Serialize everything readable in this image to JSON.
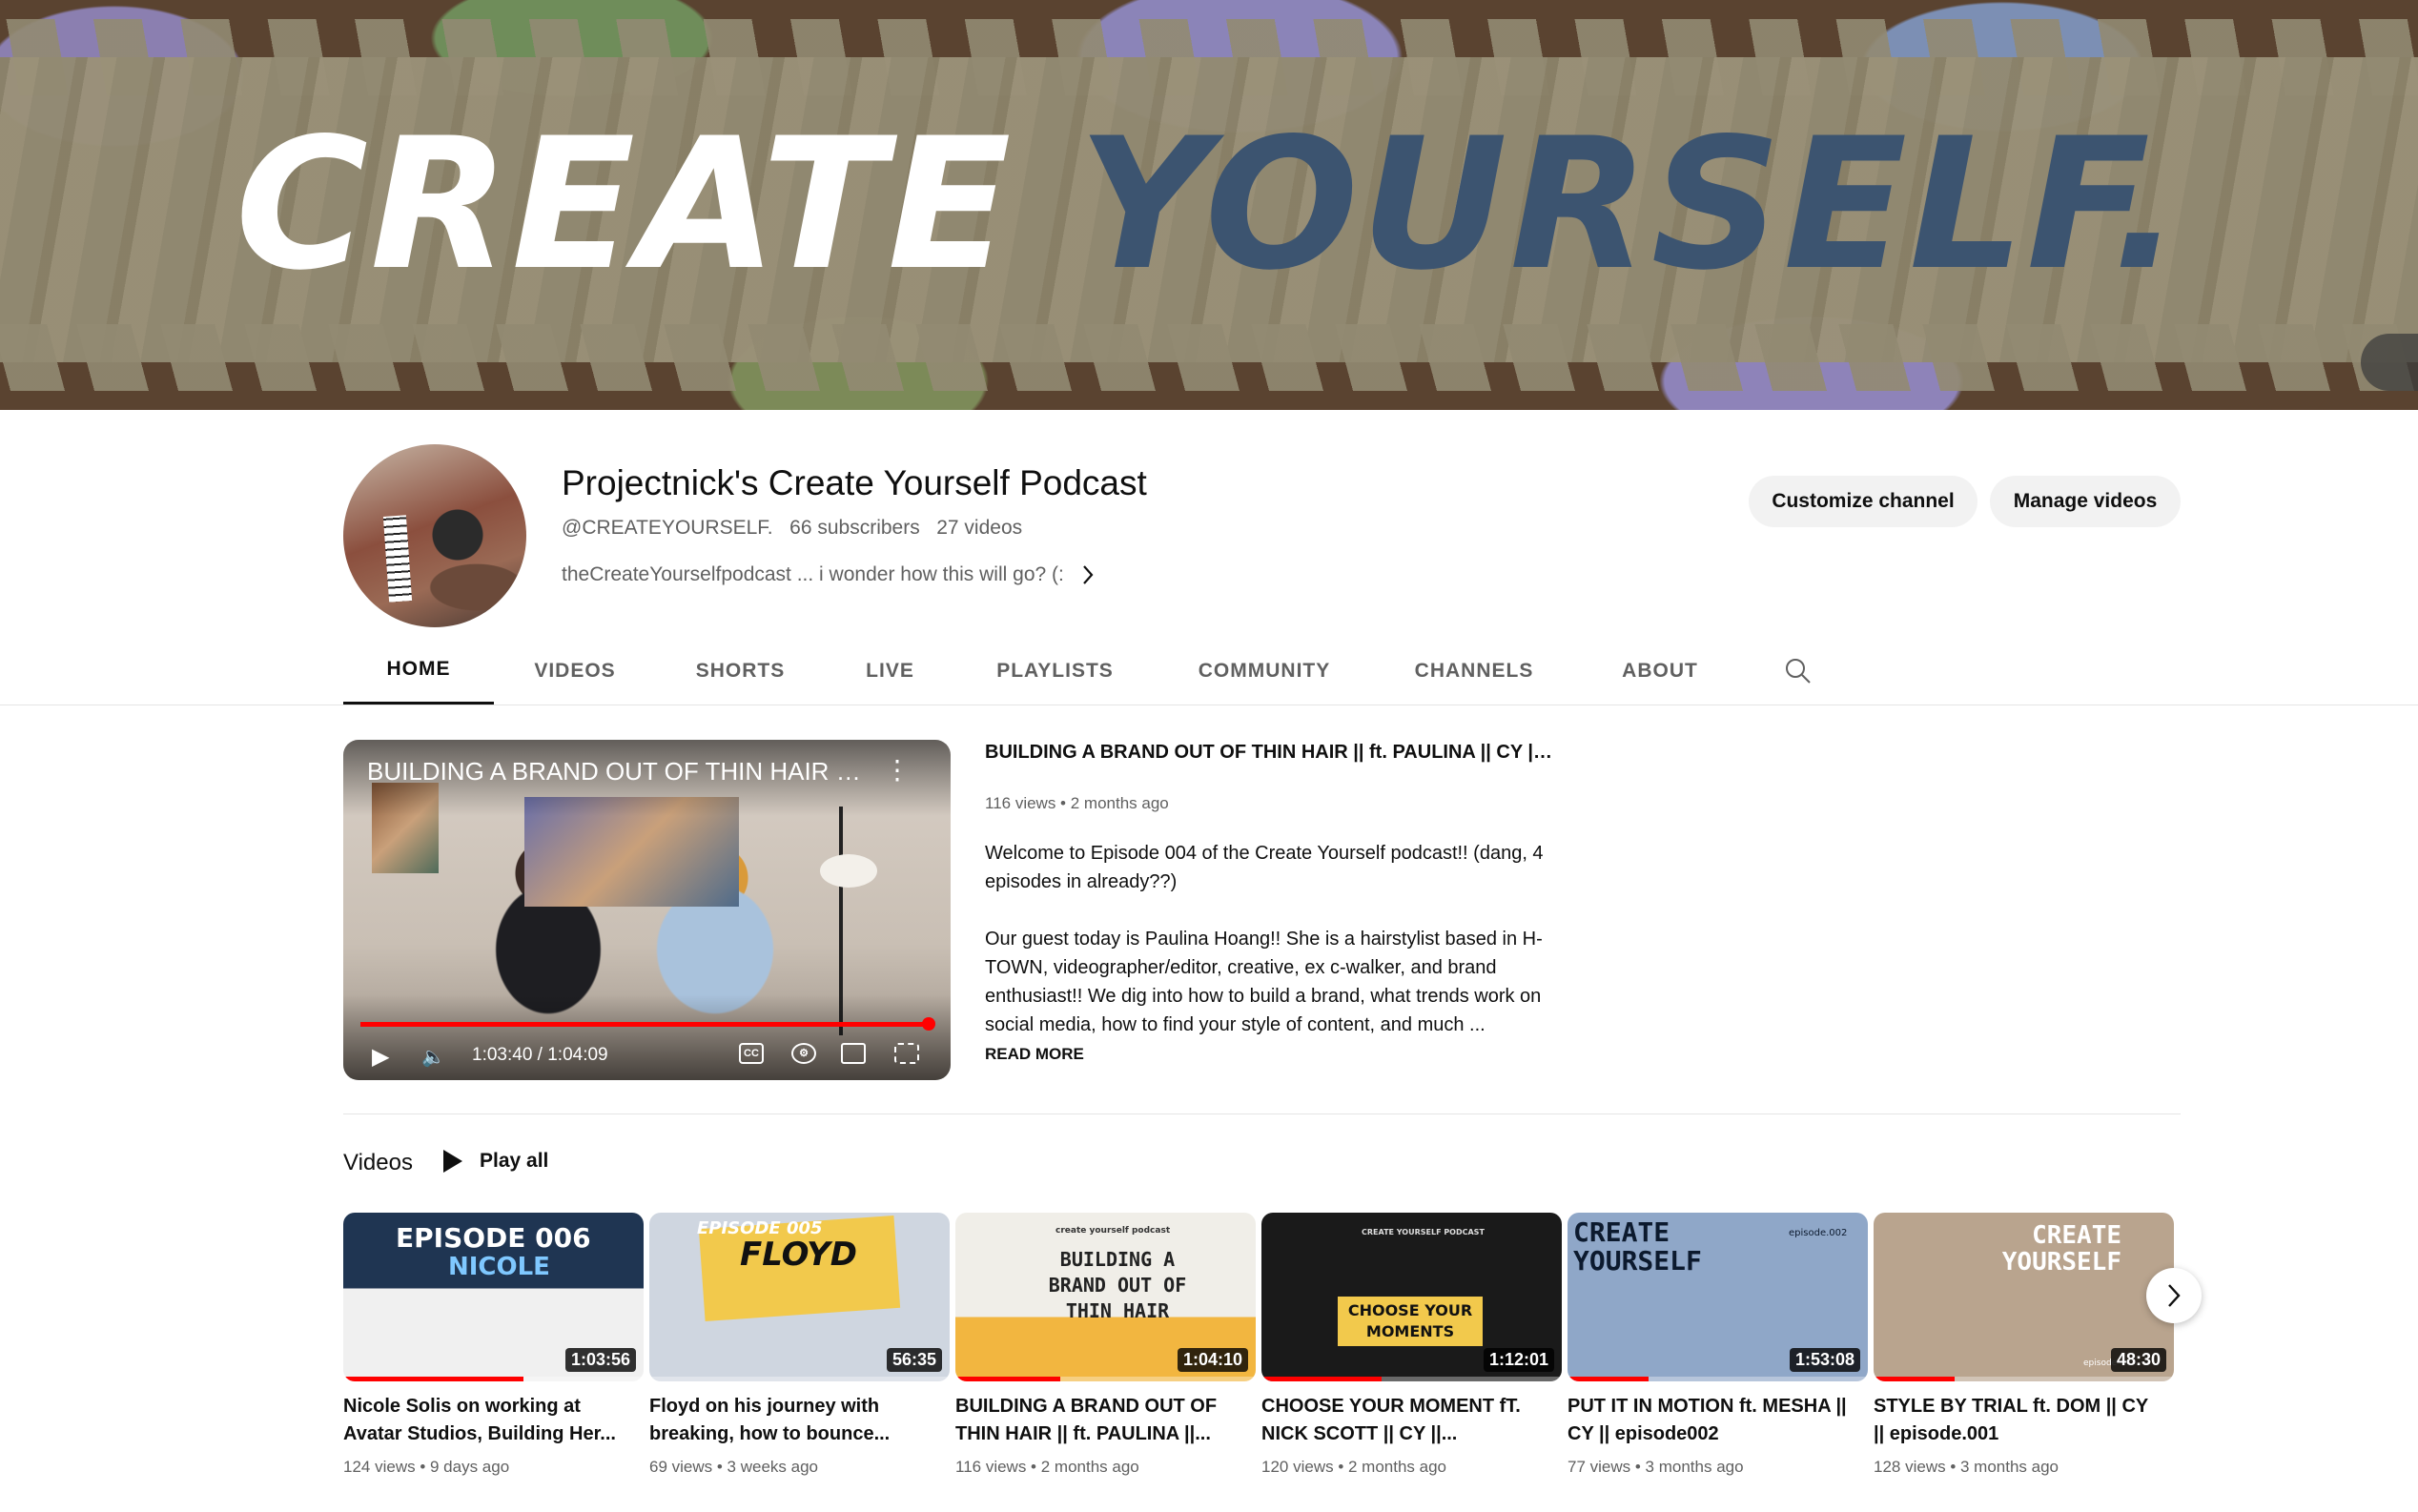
{
  "banner": {
    "text_white": "CREATE ",
    "text_blue": "YOURSELF."
  },
  "channel": {
    "name": "Projectnick's Create Yourself Podcast",
    "handle": "@CREATEYOURSELF.",
    "subscribers": "66 subscribers",
    "videos": "27 videos",
    "description": "theCreateYourselfpodcast ... i wonder how this will go? (:"
  },
  "actions": {
    "customize": "Customize channel",
    "manage": "Manage videos"
  },
  "tabs": [
    "HOME",
    "VIDEOS",
    "SHORTS",
    "LIVE",
    "PLAYLISTS",
    "COMMUNITY",
    "CHANNELS",
    "ABOUT"
  ],
  "featured": {
    "overlay_title": "BUILDING A BRAND OUT OF THIN HAIR || ...",
    "title": "BUILDING A BRAND OUT OF THIN HAIR || ft. PAULINA || CY || e...",
    "meta": "116 views • 2 months ago",
    "desc_p1": "Welcome to Episode 004 of the Create Yourself podcast!! (dang, 4 episodes in already??)",
    "desc_p2": "Our guest today is Paulina Hoang!! She is a hairstylist based in H-TOWN, videographer/editor, creative, ex c-walker, and brand enthusiast!! We dig into how to build a brand, what trends work on social media, how to find your style of content, and much ...",
    "read_more": "READ MORE",
    "time": "1:03:40 / 1:04:09",
    "progress": 0.9925
  },
  "shelf": {
    "title": "Videos",
    "play_all": "Play all",
    "videos": [
      {
        "title": "Nicole Solis on working at Avatar Studios, Building Her...",
        "meta": "124 views • 9 days ago",
        "duration": "1:03:56",
        "watched": 0.6,
        "thumb_text": "EPISODE 006",
        "thumb_sub": "NICOLE"
      },
      {
        "title": "Floyd on his journey with breaking, how to bounce...",
        "meta": "69 views • 3 weeks ago",
        "duration": "56:35",
        "watched": 0.0,
        "thumb_text": "FLOYD",
        "thumb_sub": "EPISODE 005"
      },
      {
        "title": "BUILDING A BRAND OUT OF THIN HAIR || ft. PAULINA ||...",
        "meta": "116 views • 2 months ago",
        "duration": "1:04:10",
        "watched": 0.35,
        "thumb_text": "BUILDING A BRAND OUT OF THIN HAIR",
        "thumb_sub": "create yourself podcast"
      },
      {
        "title": "CHOOSE YOUR MOMENT fT. NICK SCOTT || CY ||...",
        "meta": "120 views • 2 months ago",
        "duration": "1:12:01",
        "watched": 0.4,
        "thumb_text": "CHOOSE YOUR MOMENTS",
        "thumb_sub": "CREATE YOURSELF PODCAST"
      },
      {
        "title": "PUT IT IN MOTION ft. MESHA || CY || episode002",
        "meta": "77 views • 3 months ago",
        "duration": "1:53:08",
        "watched": 0.27,
        "thumb_text": "CREATE YOURSELF",
        "thumb_sub": "episode.002"
      },
      {
        "title": "STYLE BY TRIAL ft. DOM || CY || episode.001",
        "meta": "128 views • 3 months ago",
        "duration": "48:30",
        "watched": 0.27,
        "thumb_text": "CREATE YOURSELF",
        "thumb_sub": "episode"
      }
    ]
  },
  "colors": {
    "accent_red": "#ff0000",
    "banner_blue": "#3c5470"
  },
  "icons": [
    "chevron-right-icon",
    "search-icon",
    "play-icon",
    "volume-icon",
    "cc-icon",
    "settings-icon",
    "cast-icon",
    "fullscreen-icon",
    "more-vert-icon"
  ]
}
